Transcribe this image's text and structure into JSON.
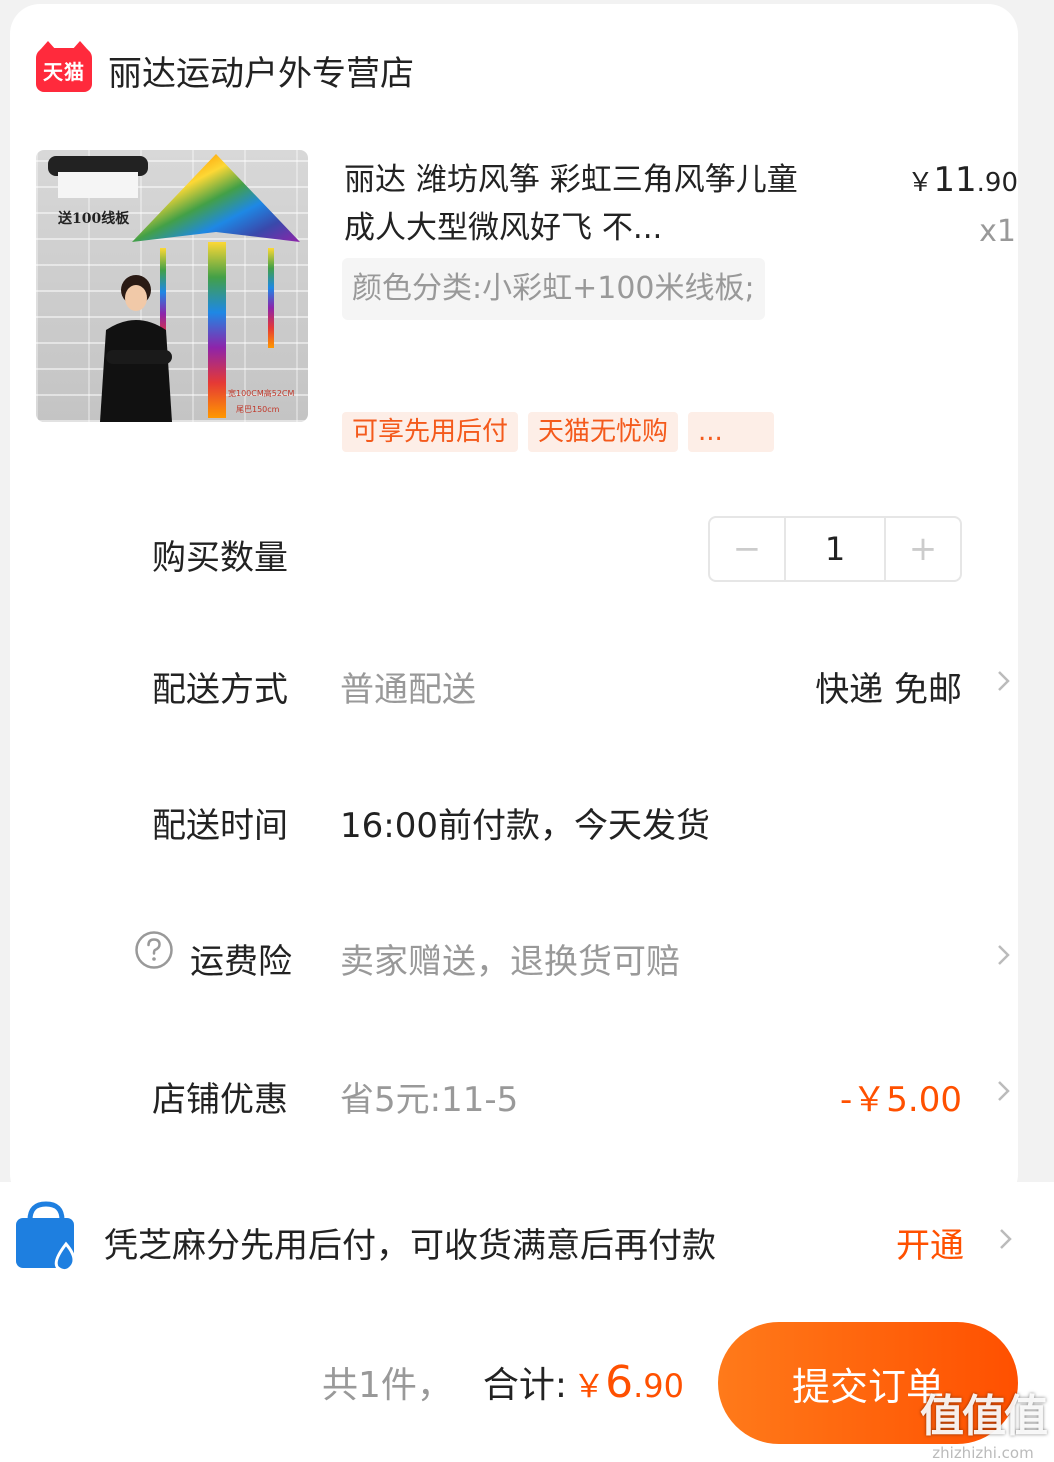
{
  "store": {
    "logo_text": "天猫",
    "name": "丽达运动户外专营店"
  },
  "product": {
    "image_promo_text": "送100线板",
    "image_spec_lines": [
      "宽100CM高52CM",
      "尾巴150cm"
    ],
    "title": "丽达 潍坊风筝 彩虹三角风筝儿童 成人大型微风好飞 不...",
    "price_yen": "￥",
    "price_int": "11",
    "price_cents": ".90",
    "quantity_label": "x1",
    "sku": "颜色分类:小彩虹+100米线板;",
    "tags": [
      "可享先用后付",
      "天猫无忧购",
      "..."
    ]
  },
  "quantity_row": {
    "label": "购买数量",
    "minus": "−",
    "value": "1",
    "plus": "+"
  },
  "delivery_row": {
    "label": "配送方式",
    "value": "普通配送",
    "right": "快递 免邮"
  },
  "delivery_time_row": {
    "label": "配送时间",
    "value": "16:00前付款，今天发货"
  },
  "insurance_row": {
    "label": "运费险",
    "value": "卖家赠送，退换货可赔"
  },
  "store_discount_row": {
    "label": "店铺优惠",
    "value": "省5元:11-5",
    "right": "-￥5.00"
  },
  "zhima": {
    "text": "凭芝麻分先用后付，可收货满意后再付款",
    "action": "开通"
  },
  "summary": {
    "count": "共1件，",
    "total_label": "合计:",
    "yen": "￥",
    "int": "6",
    "cents": ".90"
  },
  "submit_label": "提交订单",
  "watermark": {
    "big": "值值值",
    "small": "zhizhizhi.com"
  },
  "colors": {
    "accent": "#ff5000",
    "tmall_red": "#ff2a3c",
    "tag_bg": "#fdeee7",
    "muted": "#999999"
  }
}
